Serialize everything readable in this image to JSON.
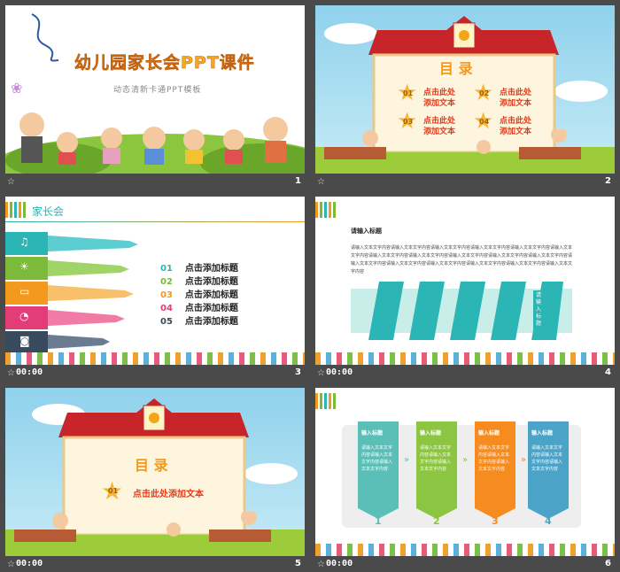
{
  "slides": [
    {
      "num": "1",
      "time": ""
    },
    {
      "num": "2",
      "time": ""
    },
    {
      "num": "3",
      "time": "00:00"
    },
    {
      "num": "4",
      "time": "00:00"
    },
    {
      "num": "5",
      "time": "00:00"
    },
    {
      "num": "6",
      "time": "00:00"
    }
  ],
  "slide1": {
    "title": "幼儿园家长会PPT课件",
    "subtitle": "动态清新卡通PPT模板"
  },
  "slide2": {
    "heading": "目 录",
    "items": [
      {
        "num": "01",
        "text1": "点击此处",
        "text2": "添加文本"
      },
      {
        "num": "02",
        "text1": "点击此处",
        "text2": "添加文本"
      },
      {
        "num": "03",
        "text1": "点击此处",
        "text2": "添加文本"
      },
      {
        "num": "04",
        "text1": "点击此处",
        "text2": "添加文本"
      }
    ]
  },
  "slide3": {
    "title": "家长会",
    "items": [
      {
        "num": "01",
        "label": "点击添加标题",
        "color": "#2bb5b4"
      },
      {
        "num": "02",
        "label": "点击添加标题",
        "color": "#7cba3b"
      },
      {
        "num": "03",
        "label": "点击添加标题",
        "color": "#f39a1e"
      },
      {
        "num": "04",
        "label": "点击添加标题",
        "color": "#e23d77"
      },
      {
        "num": "05",
        "label": "点击添加标题",
        "color": "#3a4a5e"
      }
    ]
  },
  "slide4": {
    "heading": "请输入标题",
    "body": "请输入文本文字内容请输入文本文字内容请输入文本文字内容请输入文本文字内容请输入文本文字内容请输入文本文字内容请输入文本文字内容请输入文本文字内容请输入文本文字内容请输入文本文字内容请输入文本文字内容请输入文本文字内容请输入文本文字内容请输入文本文字内容请输入文本文字内容请输入文本文字内容请输入文本文字内容",
    "ribbon_label": "请输入标题",
    "ribbon_items": [
      "请输入标题",
      "请输入标题",
      "请输入标题",
      "请输入标题",
      "请输入标题"
    ]
  },
  "slide5": {
    "heading": "目 录",
    "num": "01",
    "text": "点击此处添加文本"
  },
  "slide6": {
    "cards": [
      {
        "title": "输入标题",
        "body": "请输入文本文字内容请输入文本文字内容请输入文本文字内容",
        "num": "1",
        "color": "#5bbfb8"
      },
      {
        "title": "输入标题",
        "body": "请输入文本文字内容请输入文本文字内容请输入文本文字内容",
        "num": "2",
        "color": "#8bc541"
      },
      {
        "title": "输入标题",
        "body": "请输入文本文字内容请输入文本文字内容请输入文本文字内容",
        "num": "3",
        "color": "#f68b1f"
      },
      {
        "title": "输入标题",
        "body": "请输入文本文字内容请输入文本文字内容请输入文本文字内容",
        "num": "4",
        "color": "#4ba3c7"
      }
    ],
    "arrow": "»"
  },
  "icons": [
    "star-icon",
    "bell-icon",
    "bulb-icon",
    "monitor-icon",
    "camera-icon",
    "chart-icon",
    "butterfly-icon"
  ]
}
